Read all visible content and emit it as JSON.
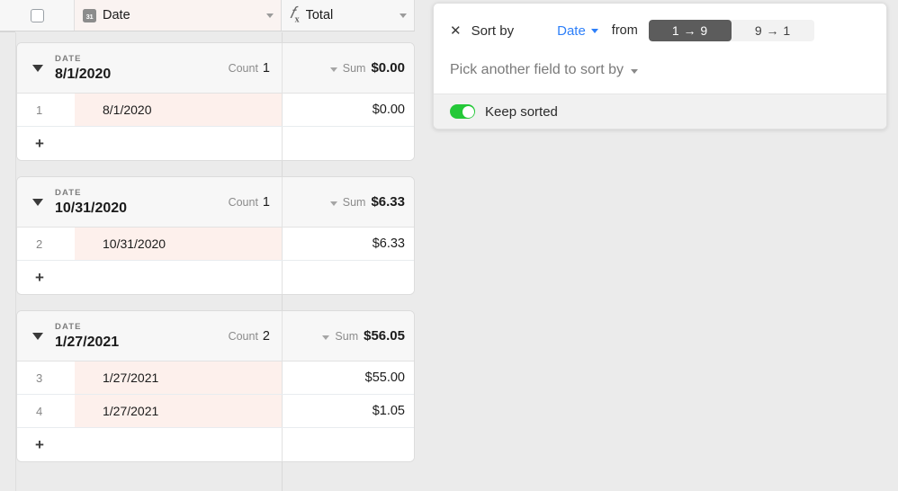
{
  "grid": {
    "header": {
      "select_all_checkbox": "unchecked",
      "columns": [
        {
          "label": "Date",
          "icon": "calendar-icon",
          "icon_glyph": "31"
        },
        {
          "label": "Total",
          "icon": "formula-fx-icon"
        }
      ]
    },
    "group_by_field": "DATE",
    "count_label": "Count",
    "sum_label": "Sum",
    "add_row_label": "+",
    "groups": [
      {
        "field_name": "DATE",
        "value": "8/1/2020",
        "count": "1",
        "sum": "$0.00",
        "rows": [
          {
            "num": "1",
            "date": "8/1/2020",
            "total": "$0.00"
          }
        ]
      },
      {
        "field_name": "DATE",
        "value": "10/31/2020",
        "count": "1",
        "sum": "$6.33",
        "rows": [
          {
            "num": "2",
            "date": "10/31/2020",
            "total": "$6.33"
          }
        ]
      },
      {
        "field_name": "DATE",
        "value": "1/27/2021",
        "count": "2",
        "sum": "$56.05",
        "rows": [
          {
            "num": "3",
            "date": "1/27/2021",
            "total": "$55.00"
          },
          {
            "num": "4",
            "date": "1/27/2021",
            "total": "$1.05"
          }
        ]
      }
    ]
  },
  "sort_panel": {
    "close_label": "✕",
    "title": "Sort by",
    "field": "Date",
    "from_label": "from",
    "direction_options": [
      {
        "label": "1 → 9",
        "active": true
      },
      {
        "label": "9 → 1",
        "active": false
      }
    ],
    "pick_another": "Pick another field to sort by",
    "keep_sorted_label": "Keep sorted",
    "keep_sorted_on": true
  },
  "colors": {
    "page_background": "#ebebeb",
    "date_cell_tint": "#fdf0ec",
    "link_blue": "#2d7ff9",
    "toggle_green": "#24c838",
    "active_button": "#5c5c5c"
  }
}
